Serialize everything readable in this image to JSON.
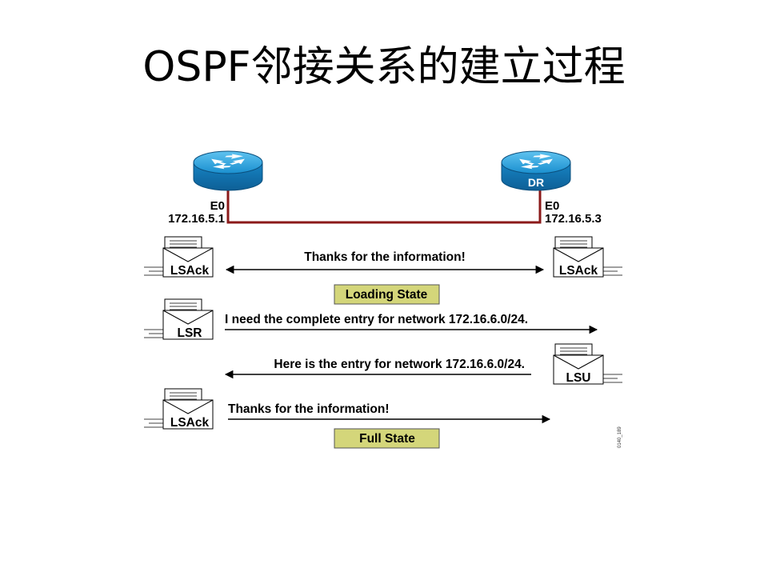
{
  "title": "OSPF邻接关系的建立过程",
  "routers": {
    "left": {
      "interface": "E0",
      "ip": "172.16.5.1",
      "role": ""
    },
    "right": {
      "interface": "E0",
      "ip": "172.16.5.3",
      "role": "DR"
    }
  },
  "messages": {
    "m1": "Thanks for the information!",
    "m2": "I need the complete entry for network 172.16.6.0/24.",
    "m3": "Here is the entry for network 172.16.6.0/24.",
    "m4": "Thanks for the information!"
  },
  "packets": {
    "p1_left": "LSAck",
    "p1_right": "LSAck",
    "p2": "LSR",
    "p3": "LSU",
    "p4": "LSAck"
  },
  "states": {
    "loading": "Loading State",
    "full": "Full State"
  },
  "figure_id": "0140_189",
  "colors": {
    "router": "#1a9ad6",
    "link": "#8b1a1a",
    "state_box": "#d4d67a"
  }
}
